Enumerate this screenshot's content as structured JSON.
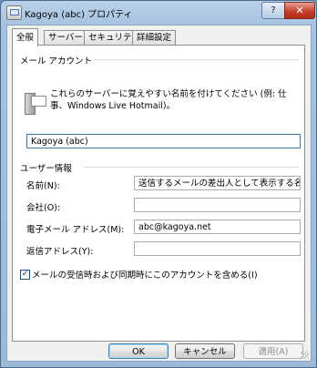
{
  "window": {
    "title": "Kagoya (abc) プロパティ",
    "help_label": "?",
    "close_label": "✕"
  },
  "tabs": [
    {
      "label": "全般"
    },
    {
      "label": "サーバー"
    },
    {
      "label": "セキュリティ"
    },
    {
      "label": "詳細設定"
    }
  ],
  "mail_account": {
    "group_title": "メール アカウント",
    "description": "これらのサーバーに覚えやすい名前を付けてください (例: 仕事、Windows Live Hotmail)。",
    "account_name": "Kagoya (abc)",
    "icon": "mail-server-icon"
  },
  "user_info": {
    "group_title": "ユーザー情報",
    "name_label": "名前(N):",
    "name_value": "送信するメールの差出人として表示する名前",
    "company_label": "会社(O):",
    "company_value": "",
    "email_label": "電子メール アドレス(M):",
    "email_value": "abc@kagoya.net",
    "reply_label": "返信アドレス(Y):",
    "reply_value": ""
  },
  "include_check": {
    "label": "メールの受信時および同期時にこのアカウントを含める(I)",
    "checked": true,
    "mark": "✓"
  },
  "buttons": {
    "ok": "OK",
    "cancel": "キャンセル",
    "apply": "適用(A)"
  }
}
